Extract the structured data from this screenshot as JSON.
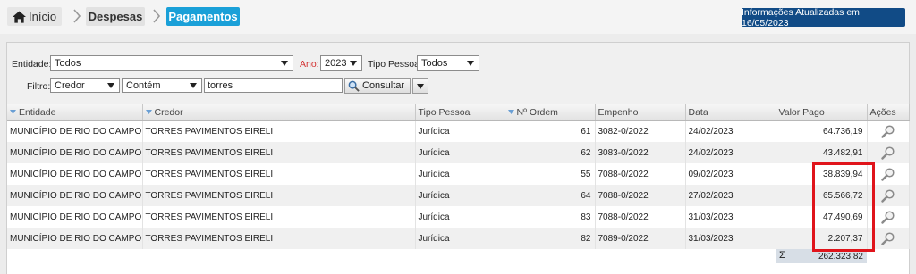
{
  "breadcrumb": {
    "home": "Início",
    "despesas": "Despesas",
    "pagamentos": "Pagamentos"
  },
  "info_badge": "Informações Atualizadas em 16/05/2023",
  "filters": {
    "entidade_label": "Entidade:",
    "entidade_value": "Todos",
    "ano_label": "Ano:",
    "ano_value": "2023",
    "tipo_pessoa_label": "Tipo Pessoa:",
    "tipo_pessoa_value": "Todos",
    "filtro_label": "Filtro:",
    "campo_value": "Credor",
    "operador_value": "Contém",
    "texto_value": "torres",
    "consultar_label": "Consultar"
  },
  "table": {
    "headers": [
      "Entidade",
      "Credor",
      "Tipo Pessoa",
      "Nº Ordem",
      "Empenho",
      "Data",
      "Valor Pago",
      "Ações"
    ],
    "rows": [
      [
        "MUNICÍPIO DE RIO DO CAMPO",
        "TORRES PAVIMENTOS EIRELI",
        "Jurídica",
        "61",
        "3082-0/2022",
        "24/02/2023",
        "64.736,19"
      ],
      [
        "MUNICÍPIO DE RIO DO CAMPO",
        "TORRES PAVIMENTOS EIRELI",
        "Jurídica",
        "62",
        "3083-0/2022",
        "24/02/2023",
        "43.482,91"
      ],
      [
        "MUNICÍPIO DE RIO DO CAMPO",
        "TORRES PAVIMENTOS EIRELI",
        "Jurídica",
        "55",
        "7088-0/2022",
        "09/02/2023",
        "38.839,94"
      ],
      [
        "MUNICÍPIO DE RIO DO CAMPO",
        "TORRES PAVIMENTOS EIRELI",
        "Jurídica",
        "64",
        "7088-0/2022",
        "27/02/2023",
        "65.566,72"
      ],
      [
        "MUNICÍPIO DE RIO DO CAMPO",
        "TORRES PAVIMENTOS EIRELI",
        "Jurídica",
        "83",
        "7088-0/2022",
        "31/03/2023",
        "47.490,69"
      ],
      [
        "MUNICÍPIO DE RIO DO CAMPO",
        "TORRES PAVIMENTOS EIRELI",
        "Jurídica",
        "82",
        "7089-0/2022",
        "31/03/2023",
        "2.207,37"
      ]
    ],
    "total_symbol": "Σ",
    "total": "262.323,82"
  },
  "colors": {
    "accent": "#1aa0d8",
    "badge": "#114b86",
    "highlight": "#e0141b"
  },
  "icons": {
    "home": "home-icon",
    "view": "magnifier-icon",
    "search": "search-icon"
  }
}
